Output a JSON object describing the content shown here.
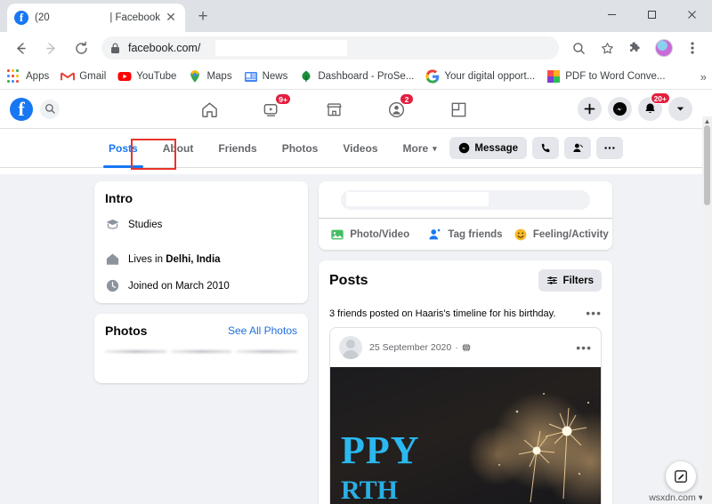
{
  "window": {
    "tab_title_left": "(20",
    "tab_title_right": "| Facebook",
    "close_tab": "✕",
    "new_tab": "+",
    "minimize": "minimize-icon",
    "maximize": "maximize-icon",
    "close": "close-icon"
  },
  "toolbar": {
    "back": "back-icon",
    "forward": "forward-icon",
    "reload": "reload-icon",
    "url": "facebook.com/",
    "lock": "lock-icon",
    "search": "search-icon",
    "bookmark_star": "star-icon",
    "extensions": "puzzle-icon",
    "profile": "profile-avatar",
    "menu": "three-dot-menu-icon"
  },
  "bookmarks": {
    "items": [
      {
        "label": "Apps",
        "icon": "apps-grid-icon"
      },
      {
        "label": "Gmail",
        "icon": "gmail-icon"
      },
      {
        "label": "YouTube",
        "icon": "youtube-icon"
      },
      {
        "label": "Maps",
        "icon": "maps-pin-icon"
      },
      {
        "label": "News",
        "icon": "google-news-icon"
      },
      {
        "label": "Dashboard - ProSe...",
        "icon": "dashboard-icon"
      },
      {
        "label": "Your digital opport...",
        "icon": "google-g-icon"
      },
      {
        "label": "PDF to Word Conve...",
        "icon": "pdf-converter-icon"
      }
    ],
    "overflow": "»"
  },
  "facebook_bar": {
    "logo": "facebook-logo",
    "search_icon": "search-icon",
    "nav": [
      {
        "name": "home",
        "icon": "home-icon",
        "badge": ""
      },
      {
        "name": "watch",
        "icon": "watch-icon",
        "badge": "9+"
      },
      {
        "name": "marketplace",
        "icon": "marketplace-icon",
        "badge": ""
      },
      {
        "name": "groups",
        "icon": "groups-icon",
        "badge": "2"
      },
      {
        "name": "gaming",
        "icon": "gaming-icon",
        "badge": ""
      }
    ],
    "right": [
      {
        "name": "create",
        "icon": "plus-icon",
        "badge": ""
      },
      {
        "name": "messenger",
        "icon": "messenger-icon",
        "badge": ""
      },
      {
        "name": "notifications",
        "icon": "bell-icon",
        "badge": "20+"
      },
      {
        "name": "account",
        "icon": "chevron-down-icon",
        "badge": ""
      }
    ]
  },
  "profile_tabs": {
    "items": [
      {
        "label": "Posts",
        "active": true
      },
      {
        "label": "About",
        "active": false
      },
      {
        "label": "Friends",
        "active": false
      },
      {
        "label": "Photos",
        "active": false
      },
      {
        "label": "Videos",
        "active": false
      },
      {
        "label": "More",
        "active": false
      }
    ],
    "more_caret": "▾",
    "highlight_target": "About",
    "highlight_color": "#e8342a"
  },
  "profile_actions": {
    "message_label": "Message",
    "message_icon": "messenger-icon",
    "call_icon": "phone-icon",
    "friend_icon": "add-friend-icon",
    "more_icon": "ellipsis-icon"
  },
  "intro_card": {
    "title": "Intro",
    "rows": [
      {
        "icon": "graduation-cap-icon",
        "prefix": "Studies",
        "bold": "",
        "suffix": ""
      },
      {
        "icon": "home-icon",
        "prefix": "Lives in ",
        "bold": "Delhi, India",
        "suffix": ""
      },
      {
        "icon": "clock-icon",
        "prefix": "Joined on March 2010",
        "bold": "",
        "suffix": ""
      }
    ]
  },
  "photos_card": {
    "title": "Photos",
    "see_all": "See All Photos"
  },
  "composer": {
    "placeholder": "",
    "actions": [
      {
        "label": "Photo/Video",
        "icon": "photo-video-icon"
      },
      {
        "label": "Tag friends",
        "icon": "tag-friends-icon"
      },
      {
        "label": "Feeling/Activity",
        "icon": "feeling-activity-icon"
      }
    ]
  },
  "posts_section": {
    "title": "Posts",
    "filters_label": "Filters",
    "filters_icon": "filters-icon"
  },
  "feed": {
    "note": "3 friends posted on Haaris's timeline for his birthday.",
    "note_menu": "•••",
    "post": {
      "date": "25 September 2020",
      "separator": "·",
      "privacy_icon": "globe-icon",
      "menu": "•••",
      "image_text_line1": "PPY",
      "image_text_line2": "RTH"
    }
  },
  "floating": {
    "compose_icon": "compose-icon"
  },
  "watermark": {
    "text": "wsxdn.com",
    "caret": "▾"
  },
  "colors": {
    "facebook_blue": "#1877f2",
    "highlight_red": "#e8342a",
    "badge_red": "#e41e3f",
    "page_bg": "#f0f2f5",
    "link_blue": "#216fdb"
  }
}
